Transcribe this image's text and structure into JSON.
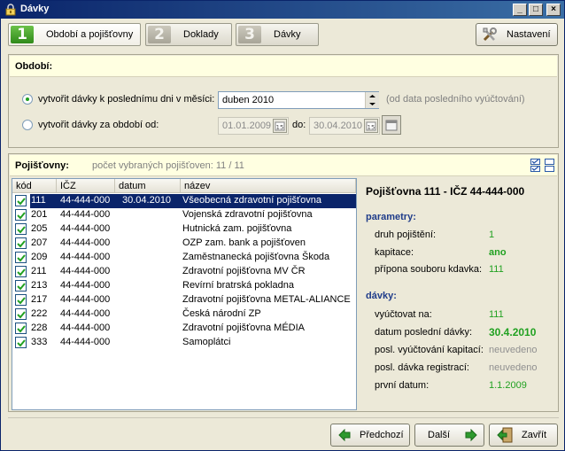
{
  "window": {
    "title": "Dávky"
  },
  "steps": [
    {
      "num": "1",
      "label": "Období a pojišťovny"
    },
    {
      "num": "2",
      "label": "Doklady"
    },
    {
      "num": "3",
      "label": "Dávky"
    }
  ],
  "settings_label": "Nastavení",
  "period": {
    "title": "Období:",
    "opt1_label": "vytvořit dávky k poslednímu dni v měsíci:",
    "month_value": "duben 2010",
    "hint": "(od data posledního vyúčtování)",
    "opt2_label": "vytvořit dávky za období od:",
    "from_value": "01.01.2009",
    "to_label": "do:",
    "to_value": "30.04.2010"
  },
  "insurers": {
    "title": "Pojišťovny:",
    "count_text": "počet vybraných pojišťoven: 11 / 11",
    "columns": [
      "kód",
      "IČZ",
      "datum",
      "název"
    ],
    "rows": [
      {
        "code": "111",
        "icz": "44-444-000",
        "date": "30.04.2010",
        "name": "Všeobecná zdravotní pojišťovna",
        "checked": true
      },
      {
        "code": "201",
        "icz": "44-444-000",
        "date": "",
        "name": "Vojenská zdravotní pojišťovna",
        "checked": true
      },
      {
        "code": "205",
        "icz": "44-444-000",
        "date": "",
        "name": "Hutnická zam. pojišťovna",
        "checked": true
      },
      {
        "code": "207",
        "icz": "44-444-000",
        "date": "",
        "name": "OZP zam. bank a pojišťoven",
        "checked": true
      },
      {
        "code": "209",
        "icz": "44-444-000",
        "date": "",
        "name": "Zaměstnanecká pojišťovna Škoda",
        "checked": true
      },
      {
        "code": "211",
        "icz": "44-444-000",
        "date": "",
        "name": "Zdravotní pojišťovna MV ČR",
        "checked": true
      },
      {
        "code": "213",
        "icz": "44-444-000",
        "date": "",
        "name": "Revírní bratrská pokladna",
        "checked": true
      },
      {
        "code": "217",
        "icz": "44-444-000",
        "date": "",
        "name": "Zdravotní pojišťovna METAL-ALIANCE",
        "checked": true
      },
      {
        "code": "222",
        "icz": "44-444-000",
        "date": "",
        "name": "Česká národní ZP",
        "checked": true
      },
      {
        "code": "228",
        "icz": "44-444-000",
        "date": "",
        "name": "Zdravotní pojišťovna MÉDIA",
        "checked": true
      },
      {
        "code": "333",
        "icz": "44-444-000",
        "date": "",
        "name": "Samoplátci",
        "checked": true
      }
    ]
  },
  "detail": {
    "title": "Pojišťovna 111 - IČZ 44-444-000",
    "params_title": "parametry:",
    "params": [
      {
        "label": "druh pojištění:",
        "value": "1"
      },
      {
        "label": "kapitace:",
        "value": "ano"
      },
      {
        "label": "přípona souboru kdavka:",
        "value": "111"
      }
    ],
    "batches_title": "dávky:",
    "batches": [
      {
        "label": "vyúčtovat na:",
        "value": "111"
      },
      {
        "label": "datum poslední dávky:",
        "value": "30.4.2010"
      },
      {
        "label": "posl. vyúčtování kapitací:",
        "value": "neuvedeno"
      },
      {
        "label": "posl. dávka registrací:",
        "value": "neuvedeno"
      },
      {
        "label": "první datum:",
        "value": "1.1.2009"
      }
    ]
  },
  "footer": {
    "prev_label": "Předchozí",
    "next_label": "Další",
    "close_label": "Zavřít"
  },
  "colors": {
    "accent_green": "#21a121",
    "title_blue": "#0a246a",
    "section_blue": "#1f3c8a",
    "hint_yellow": "#ffffe1"
  },
  "icons": [
    "app-lock-icon",
    "minimize-icon",
    "maximize-icon",
    "close-icon",
    "tools-icon",
    "calendar-icon",
    "check-all-icon",
    "uncheck-all-icon",
    "arrow-left-icon",
    "arrow-right-icon",
    "exit-door-icon"
  ]
}
